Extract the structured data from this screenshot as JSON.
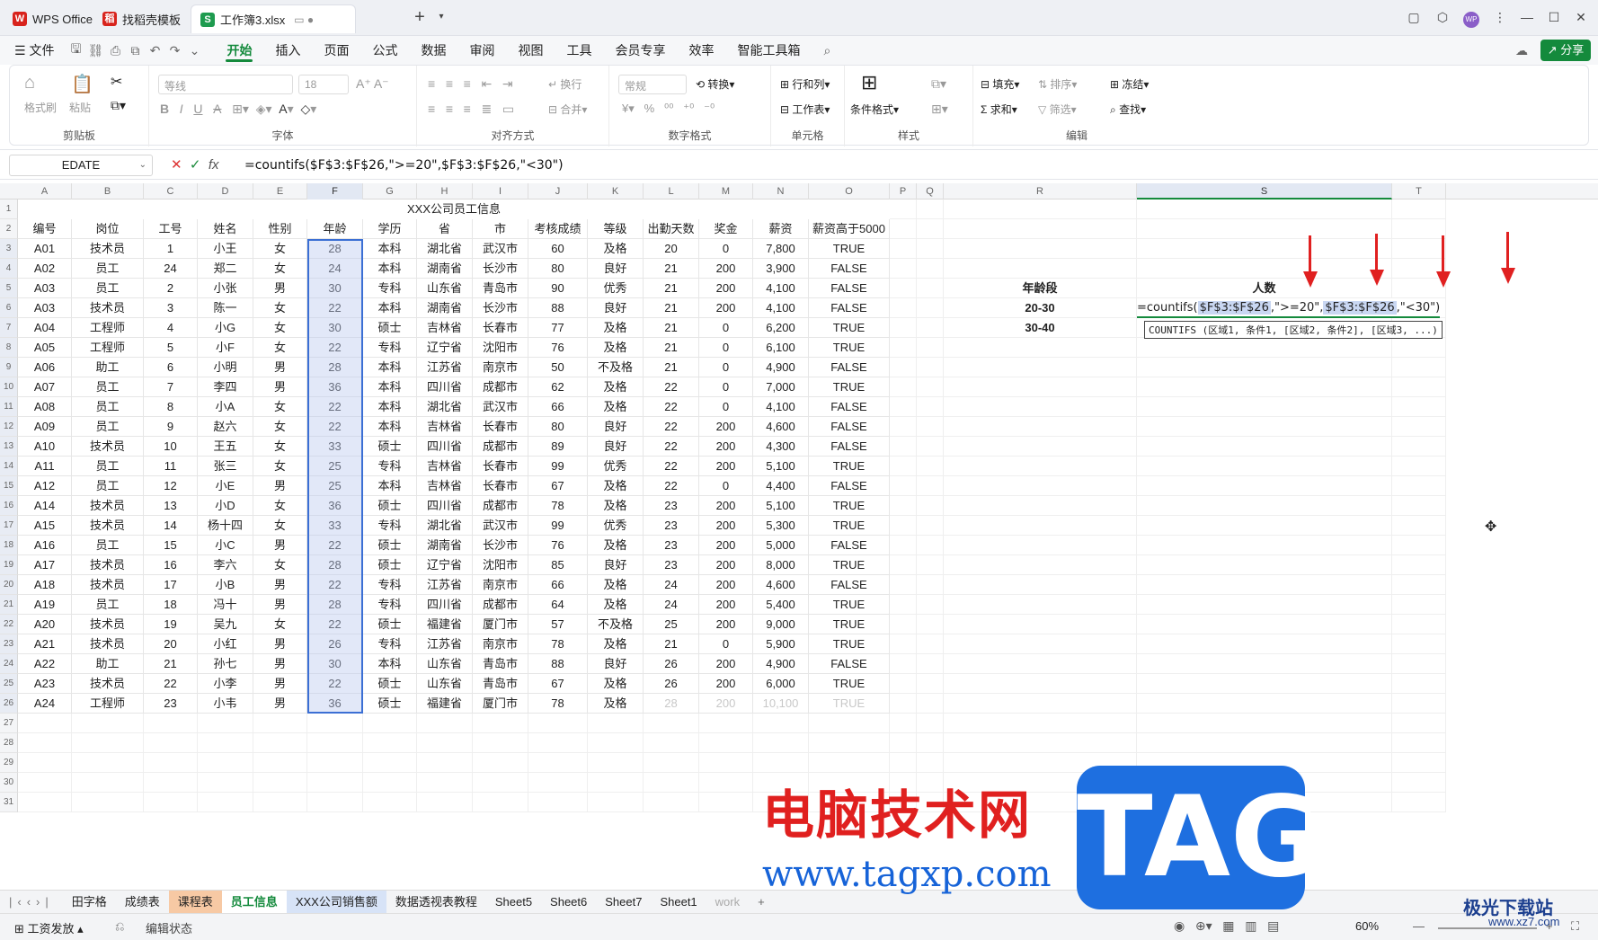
{
  "titlebar": {
    "tabs": [
      {
        "label": "WPS Office",
        "color": "#d8231c"
      },
      {
        "label": "找稻壳模板",
        "color": "#d8231c"
      },
      {
        "label": "工作簿3.xlsx",
        "color": "#1e9b4f"
      }
    ],
    "new_tab": "+"
  },
  "menu": {
    "file": "文件",
    "items": [
      "开始",
      "插入",
      "页面",
      "公式",
      "数据",
      "审阅",
      "视图",
      "工具",
      "会员专享",
      "效率",
      "智能工具箱"
    ],
    "active": "开始",
    "share": "分享"
  },
  "ribbon": {
    "groups": [
      "剪贴板",
      "字体",
      "对齐方式",
      "数字格式",
      "单元格",
      "样式",
      "编辑"
    ],
    "clipboard": [
      "格式刷",
      "粘贴"
    ],
    "font_name": "等线",
    "font_size": "18",
    "align": [
      "换行",
      "合并"
    ],
    "number_format": "常规",
    "convert": "转换",
    "cells": [
      "行和列",
      "工作表"
    ],
    "style": [
      "条件格式"
    ],
    "edit": [
      "填充",
      "排序",
      "冻结",
      "求和",
      "筛选",
      "查找"
    ]
  },
  "formula_bar": {
    "name_box": "EDATE",
    "fx": "fx",
    "formula": "=countifs($F$3:$F$26,\">=20\",$F$3:$F$26,\"<30\")"
  },
  "columns": [
    "A",
    "B",
    "C",
    "D",
    "E",
    "F",
    "G",
    "H",
    "I",
    "J",
    "K",
    "L",
    "M",
    "N",
    "O",
    "P",
    "Q",
    "R",
    "S",
    "T"
  ],
  "sheet_title": "XXX公司员工信息",
  "headers": [
    "编号",
    "岗位",
    "工号",
    "姓名",
    "性别",
    "年龄",
    "学历",
    "省",
    "市",
    "考核成绩",
    "等级",
    "出勤天数",
    "奖金",
    "薪资",
    "薪资高于5000"
  ],
  "rows": [
    [
      "A01",
      "技术员",
      "1",
      "小王",
      "女",
      "28",
      "本科",
      "湖北省",
      "武汉市",
      "60",
      "及格",
      "20",
      "0",
      "7,800",
      "TRUE"
    ],
    [
      "A02",
      "员工",
      "24",
      "郑二",
      "女",
      "24",
      "本科",
      "湖南省",
      "长沙市",
      "80",
      "良好",
      "21",
      "200",
      "3,900",
      "FALSE"
    ],
    [
      "A03",
      "员工",
      "2",
      "小张",
      "男",
      "30",
      "专科",
      "山东省",
      "青岛市",
      "90",
      "优秀",
      "21",
      "200",
      "4,100",
      "FALSE"
    ],
    [
      "A03",
      "技术员",
      "3",
      "陈一",
      "女",
      "22",
      "本科",
      "湖南省",
      "长沙市",
      "88",
      "良好",
      "21",
      "200",
      "4,100",
      "FALSE"
    ],
    [
      "A04",
      "工程师",
      "4",
      "小G",
      "女",
      "30",
      "硕士",
      "吉林省",
      "长春市",
      "77",
      "及格",
      "21",
      "0",
      "6,200",
      "TRUE"
    ],
    [
      "A05",
      "工程师",
      "5",
      "小F",
      "女",
      "22",
      "专科",
      "辽宁省",
      "沈阳市",
      "76",
      "及格",
      "21",
      "0",
      "6,100",
      "TRUE"
    ],
    [
      "A06",
      "助工",
      "6",
      "小明",
      "男",
      "28",
      "本科",
      "江苏省",
      "南京市",
      "50",
      "不及格",
      "21",
      "0",
      "4,900",
      "FALSE"
    ],
    [
      "A07",
      "员工",
      "7",
      "李四",
      "男",
      "36",
      "本科",
      "四川省",
      "成都市",
      "62",
      "及格",
      "22",
      "0",
      "7,000",
      "TRUE"
    ],
    [
      "A08",
      "员工",
      "8",
      "小A",
      "女",
      "22",
      "本科",
      "湖北省",
      "武汉市",
      "66",
      "及格",
      "22",
      "0",
      "4,100",
      "FALSE"
    ],
    [
      "A09",
      "员工",
      "9",
      "赵六",
      "女",
      "22",
      "本科",
      "吉林省",
      "长春市",
      "80",
      "良好",
      "22",
      "200",
      "4,600",
      "FALSE"
    ],
    [
      "A10",
      "技术员",
      "10",
      "王五",
      "女",
      "33",
      "硕士",
      "四川省",
      "成都市",
      "89",
      "良好",
      "22",
      "200",
      "4,300",
      "FALSE"
    ],
    [
      "A11",
      "员工",
      "11",
      "张三",
      "女",
      "25",
      "专科",
      "吉林省",
      "长春市",
      "99",
      "优秀",
      "22",
      "200",
      "5,100",
      "TRUE"
    ],
    [
      "A12",
      "员工",
      "12",
      "小E",
      "男",
      "25",
      "本科",
      "吉林省",
      "长春市",
      "67",
      "及格",
      "22",
      "0",
      "4,400",
      "FALSE"
    ],
    [
      "A14",
      "技术员",
      "13",
      "小D",
      "女",
      "36",
      "硕士",
      "四川省",
      "成都市",
      "78",
      "及格",
      "23",
      "200",
      "5,100",
      "TRUE"
    ],
    [
      "A15",
      "技术员",
      "14",
      "杨十四",
      "女",
      "33",
      "专科",
      "湖北省",
      "武汉市",
      "99",
      "优秀",
      "23",
      "200",
      "5,300",
      "TRUE"
    ],
    [
      "A16",
      "员工",
      "15",
      "小C",
      "男",
      "22",
      "硕士",
      "湖南省",
      "长沙市",
      "76",
      "及格",
      "23",
      "200",
      "5,000",
      "FALSE"
    ],
    [
      "A17",
      "技术员",
      "16",
      "李六",
      "女",
      "28",
      "硕士",
      "辽宁省",
      "沈阳市",
      "85",
      "良好",
      "23",
      "200",
      "8,000",
      "TRUE"
    ],
    [
      "A18",
      "技术员",
      "17",
      "小B",
      "男",
      "22",
      "专科",
      "江苏省",
      "南京市",
      "66",
      "及格",
      "24",
      "200",
      "4,600",
      "FALSE"
    ],
    [
      "A19",
      "员工",
      "18",
      "冯十",
      "男",
      "28",
      "专科",
      "四川省",
      "成都市",
      "64",
      "及格",
      "24",
      "200",
      "5,400",
      "TRUE"
    ],
    [
      "A20",
      "技术员",
      "19",
      "吴九",
      "女",
      "22",
      "硕士",
      "福建省",
      "厦门市",
      "57",
      "不及格",
      "25",
      "200",
      "9,000",
      "TRUE"
    ],
    [
      "A21",
      "技术员",
      "20",
      "小红",
      "男",
      "26",
      "专科",
      "江苏省",
      "南京市",
      "78",
      "及格",
      "21",
      "0",
      "5,900",
      "TRUE"
    ],
    [
      "A22",
      "助工",
      "21",
      "孙七",
      "男",
      "30",
      "本科",
      "山东省",
      "青岛市",
      "88",
      "良好",
      "26",
      "200",
      "4,900",
      "FALSE"
    ],
    [
      "A23",
      "技术员",
      "22",
      "小李",
      "男",
      "22",
      "硕士",
      "山东省",
      "青岛市",
      "67",
      "及格",
      "26",
      "200",
      "6,000",
      "TRUE"
    ],
    [
      "A24",
      "工程师",
      "23",
      "小韦",
      "男",
      "36",
      "硕士",
      "福建省",
      "厦门市",
      "78",
      "及格",
      "28",
      "200",
      "10,100",
      "TRUE"
    ]
  ],
  "side": {
    "age_header": "年龄段",
    "count_header": "人数",
    "age_ranges": [
      "20-30",
      "30-40"
    ],
    "edit_parts": [
      "=countifs(",
      "$F$3:$F$26",
      ",\">=20\",",
      "$F$3:$F$26",
      ",\"<30\")"
    ],
    "tooltip": "COUNTIFS (区域1, 条件1, [区域2, 条件2], [区域3, ...)"
  },
  "sheets": [
    {
      "label": "田字格",
      "style": ""
    },
    {
      "label": "成绩表",
      "style": ""
    },
    {
      "label": "课程表",
      "style": "orange"
    },
    {
      "label": "员工信息",
      "style": "active"
    },
    {
      "label": "XXX公司销售额",
      "style": "blue"
    },
    {
      "label": "数据透视表教程",
      "style": ""
    },
    {
      "label": "Sheet5",
      "style": ""
    },
    {
      "label": "Sheet6",
      "style": ""
    },
    {
      "label": "Sheet7",
      "style": ""
    },
    {
      "label": "Sheet1",
      "style": ""
    },
    {
      "label": "work",
      "style": "gray"
    }
  ],
  "status": {
    "left": "工资发放",
    "mode": "编辑状态",
    "zoom": "60%"
  },
  "watermark": {
    "cn": "电脑技术网",
    "tag": "TAG",
    "url": "www.tagxp.com",
    "site": "极光下载站",
    "site_url": "www.xz7.com"
  }
}
